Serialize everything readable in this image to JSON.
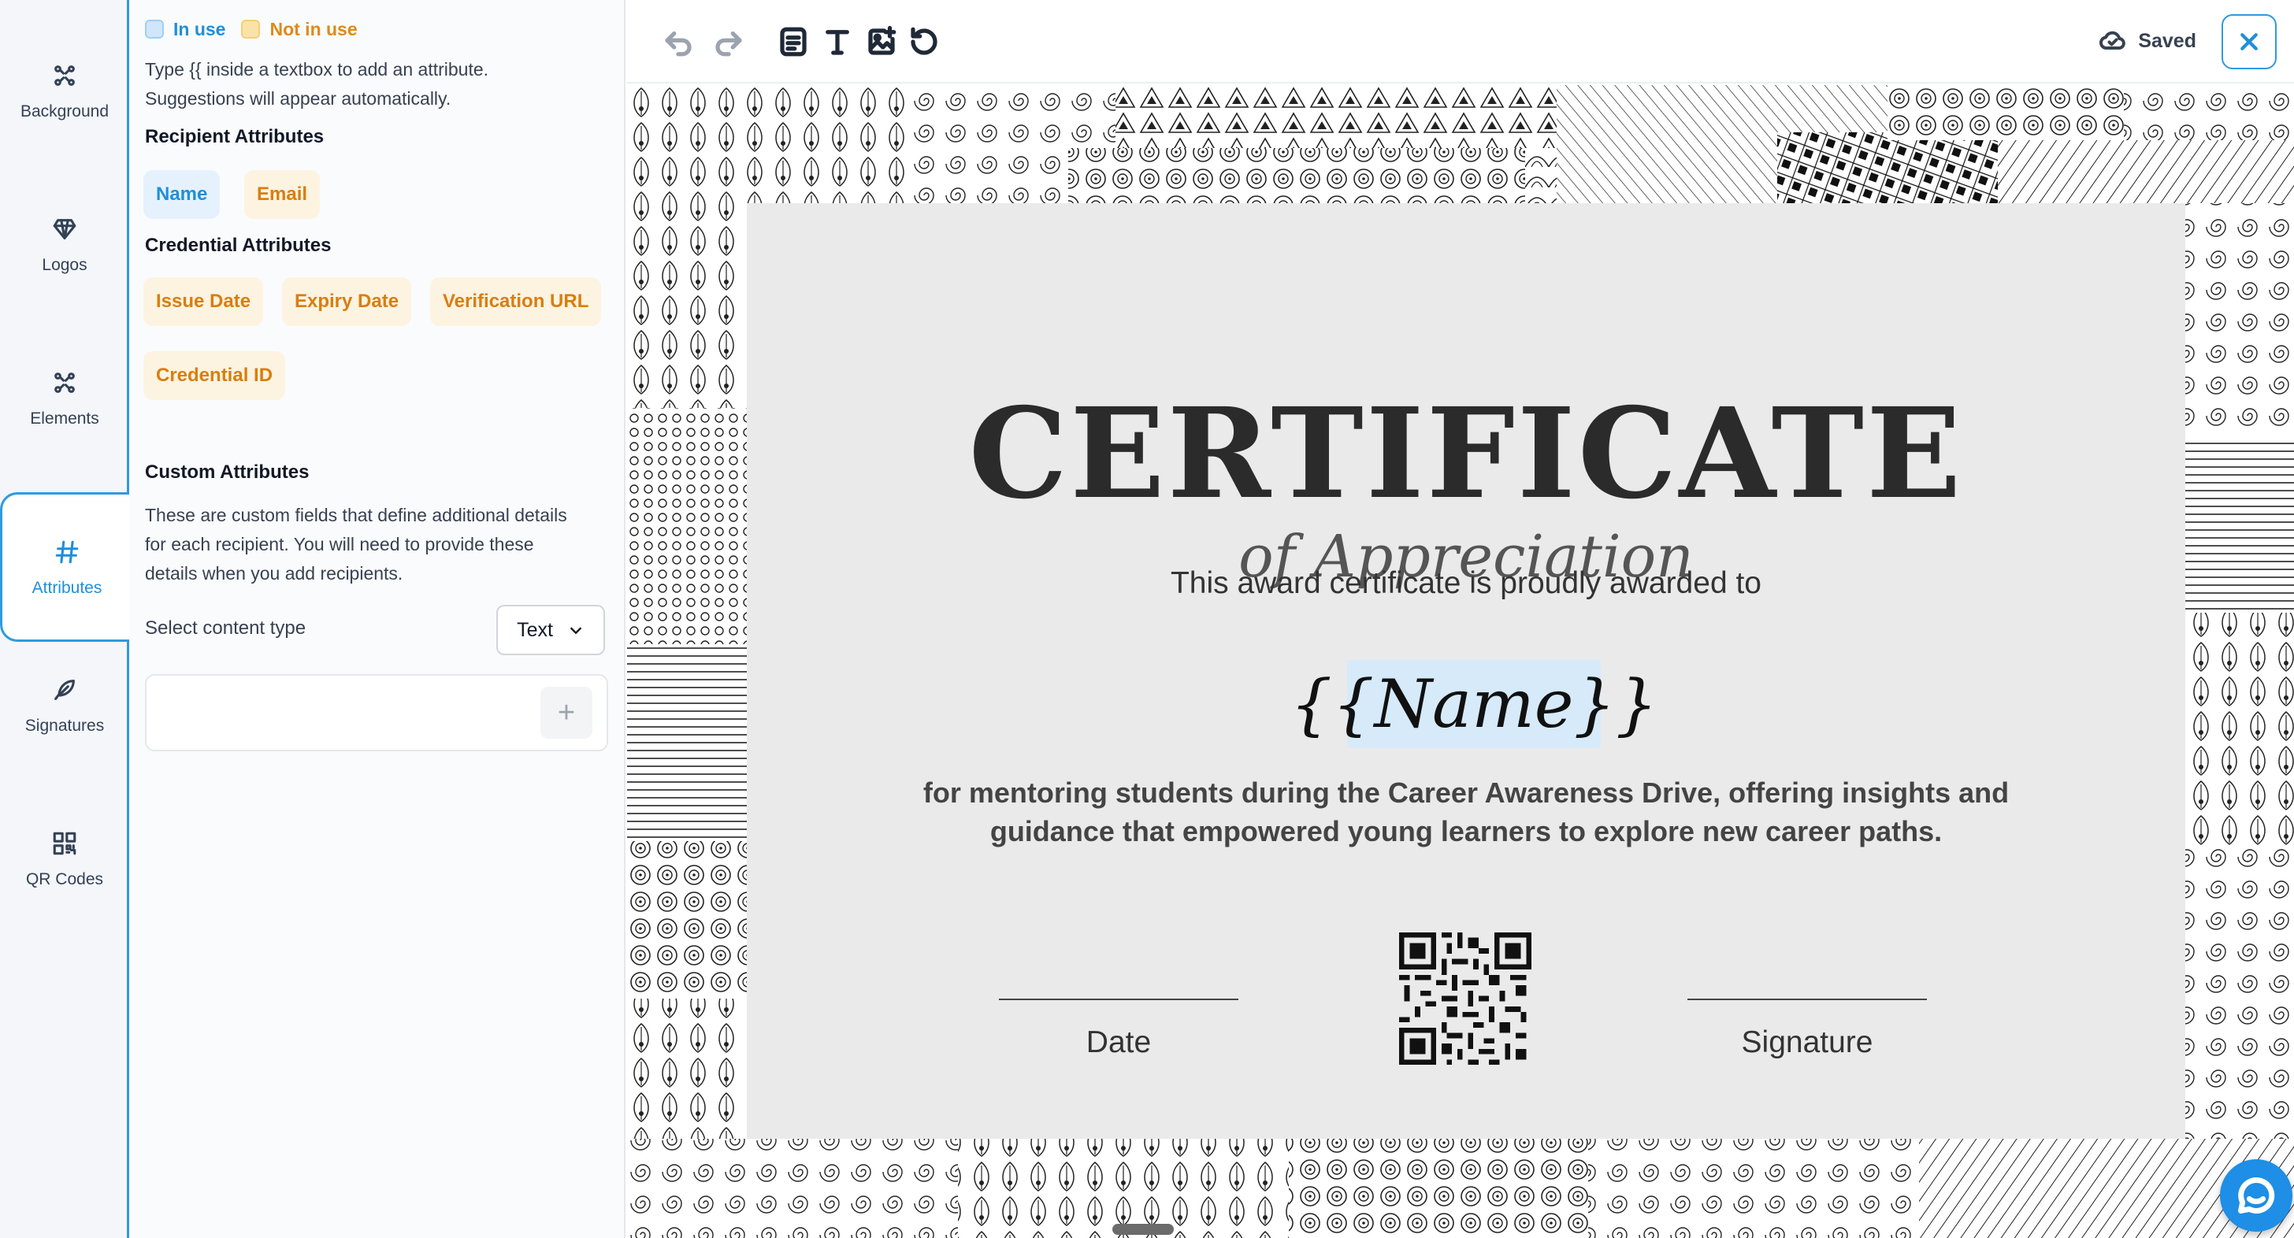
{
  "sidebar": {
    "items": [
      {
        "label": "Background",
        "icon": "background-icon",
        "active": false
      },
      {
        "label": "Logos",
        "icon": "diamond-icon",
        "active": false
      },
      {
        "label": "Elements",
        "icon": "elements-icon",
        "active": false
      },
      {
        "label": "Attributes",
        "icon": "hash-icon",
        "active": true
      },
      {
        "label": "Signatures",
        "icon": "pen-icon",
        "active": false
      },
      {
        "label": "QR Codes",
        "icon": "qr-code-icon",
        "active": false
      }
    ]
  },
  "panel": {
    "legend": {
      "in_use": "In use",
      "not_in_use": "Not in use",
      "in_use_color": "#1f8fd9",
      "not_in_use_color": "#e08a16"
    },
    "help_text": "Type {{ inside a textbox to add an attribute. Suggestions will appear automatically.",
    "recipient_title": "Recipient Attributes",
    "recipient_attributes": [
      {
        "label": "Name",
        "status": "in_use"
      },
      {
        "label": "Email",
        "status": "not_in_use"
      }
    ],
    "credential_title": "Credential Attributes",
    "credential_attributes": [
      {
        "label": "Issue Date",
        "status": "not_in_use"
      },
      {
        "label": "Expiry Date",
        "status": "not_in_use"
      },
      {
        "label": "Verification URL",
        "status": "not_in_use"
      },
      {
        "label": "Credential ID",
        "status": "not_in_use"
      }
    ],
    "custom_title": "Custom Attributes",
    "custom_description": "These are custom fields that define additional details for each recipient. You will need to provide these details when you add recipients.",
    "content_type_label": "Select content type",
    "content_type_value": "Text",
    "custom_input_value": "",
    "add_symbol": "+"
  },
  "toolbar": {
    "tools": [
      "undo-icon",
      "redo-icon",
      "text-block-icon",
      "text-icon",
      "add-image-icon",
      "reset-icon"
    ],
    "saved_label": "Saved",
    "close_symbol": "×"
  },
  "certificate": {
    "title": "CERTIFICATE",
    "subtitle": "of Appreciation",
    "awarded_line": "This award certificate is proudly awarded to",
    "recipient_placeholder": "{{Name}}",
    "description": "for mentoring students during the Career Awareness Drive, offering insights and guidance that empowered young learners to explore new career paths.",
    "date_label": "Date",
    "signature_label": "Signature"
  },
  "colors": {
    "accent": "#2f9ae0",
    "chat_button": "#1e8ee6",
    "certificate_bg": "#eaeaea",
    "name_highlight": "#d6eafa"
  }
}
